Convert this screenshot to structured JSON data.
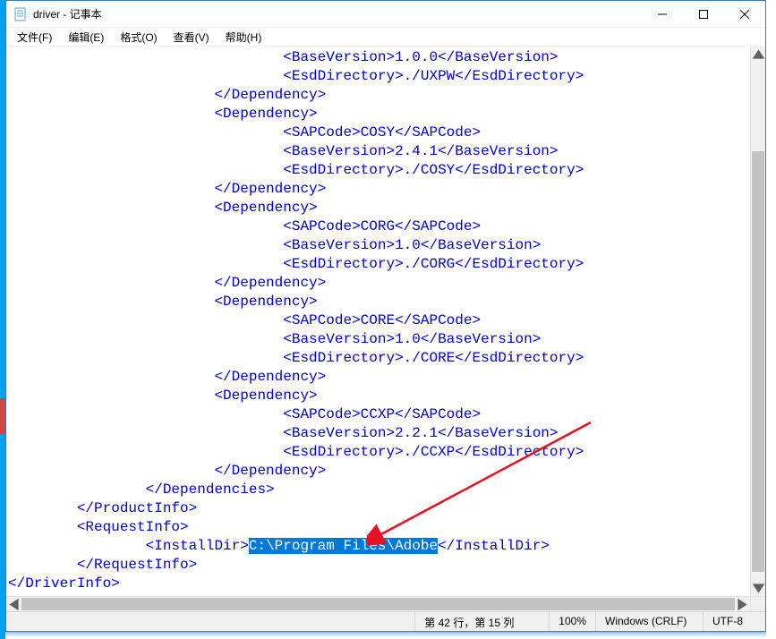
{
  "window": {
    "title": "driver - 记事本"
  },
  "menus": {
    "file": "文件(F)",
    "edit": "编辑(E)",
    "format": "格式(O)",
    "view": "查看(V)",
    "help": "帮助(H)"
  },
  "content": {
    "indent": {
      "l0": "",
      "l1": "        ",
      "l2": "                ",
      "l3": "                        ",
      "l4": "                                "
    },
    "lines": {
      "d1_base": "<BaseVersion>1.0.0</BaseVersion>",
      "d1_esd": "<EsdDirectory>./UXPW</EsdDirectory>",
      "dep_close": "</Dependency>",
      "dep_open": "<Dependency>",
      "d2_sap": "<SAPCode>COSY</SAPCode>",
      "d2_base": "<BaseVersion>2.4.1</BaseVersion>",
      "d2_esd": "<EsdDirectory>./COSY</EsdDirectory>",
      "d3_sap": "<SAPCode>CORG</SAPCode>",
      "d3_base": "<BaseVersion>1.0</BaseVersion>",
      "d3_esd": "<EsdDirectory>./CORG</EsdDirectory>",
      "d4_sap": "<SAPCode>CORE</SAPCode>",
      "d4_base": "<BaseVersion>1.0</BaseVersion>",
      "d4_esd": "<EsdDirectory>./CORE</EsdDirectory>",
      "d5_sap": "<SAPCode>CCXP</SAPCode>",
      "d5_base": "<BaseVersion>2.2.1</BaseVersion>",
      "d5_esd": "<EsdDirectory>./CCXP</EsdDirectory>",
      "deps_close": "</Dependencies>",
      "prodinfo_close": "</ProductInfo>",
      "reqinfo_open": "<RequestInfo>",
      "installdir_open": "<InstallDir>",
      "installdir_sel": "C:\\Program Files\\Adobe",
      "installdir_close": "</InstallDir>",
      "reqinfo_close": "</RequestInfo>",
      "driverinfo_close": "</DriverInfo>"
    }
  },
  "status": {
    "position": "第 42 行，第 15 列",
    "zoom": "100%",
    "lineend": "Windows (CRLF)",
    "encoding": "UTF-8"
  }
}
